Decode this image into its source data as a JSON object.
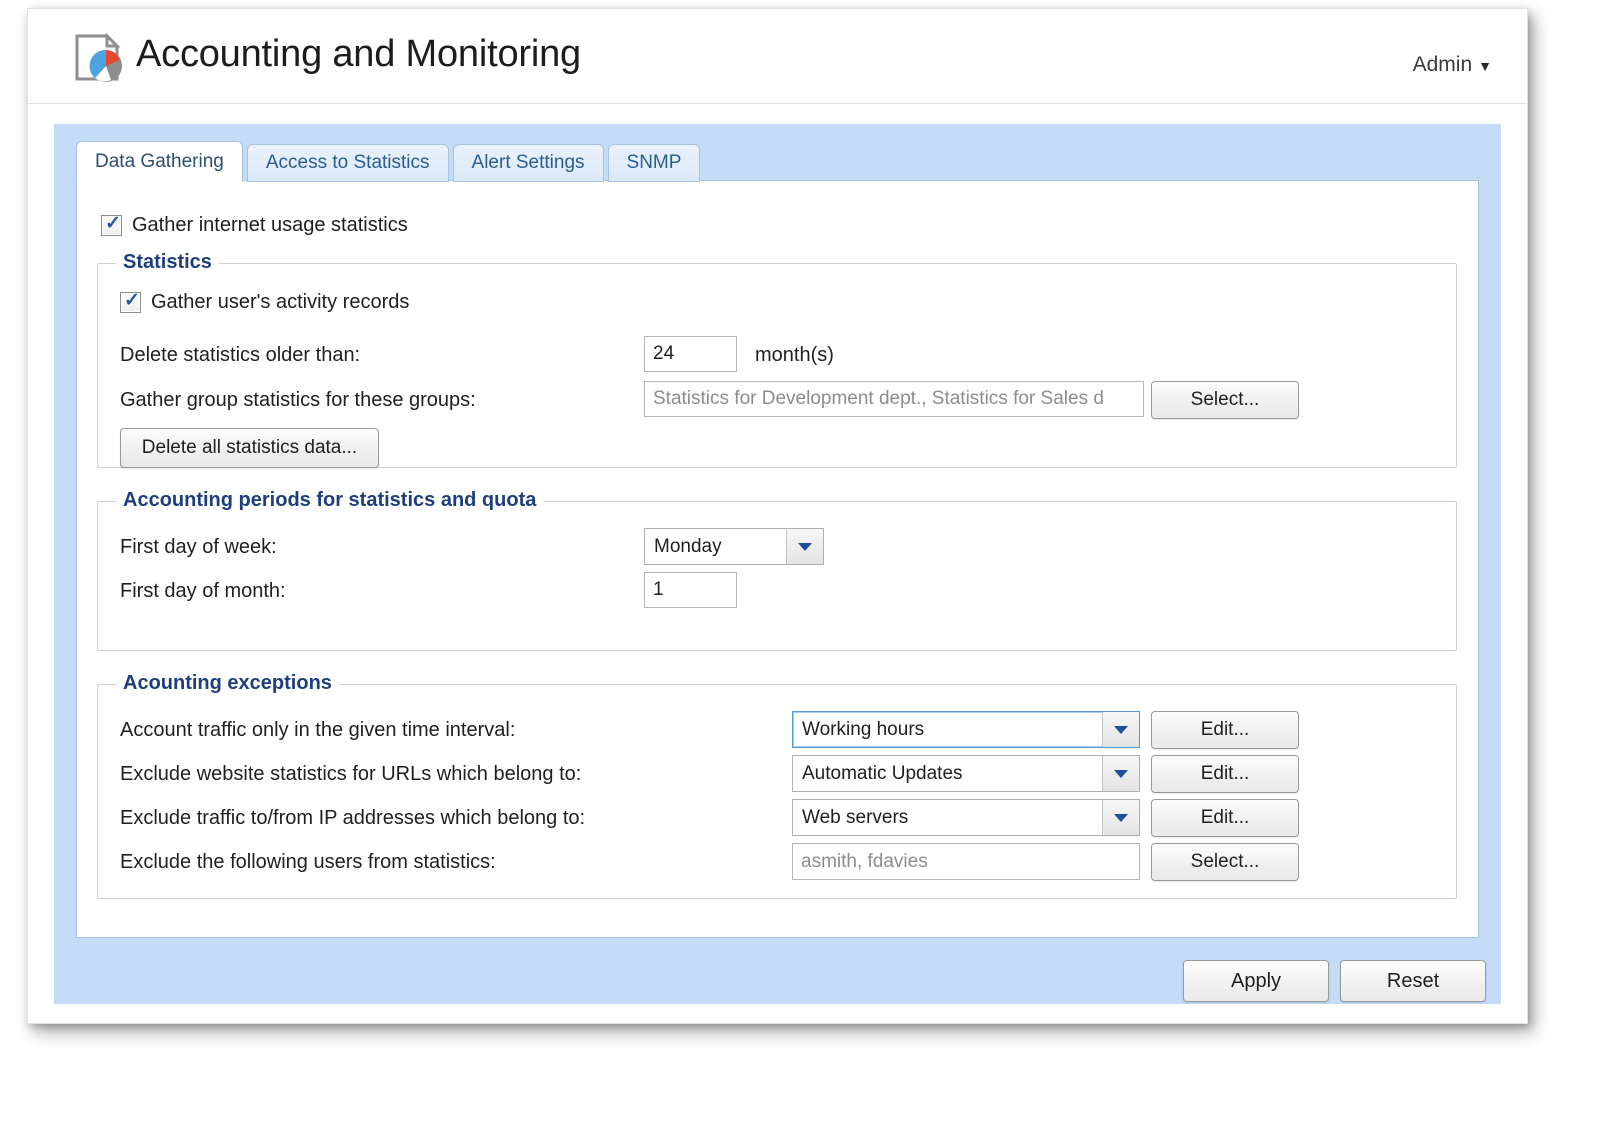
{
  "header": {
    "title": "Accounting and Monitoring",
    "icon": "document-pie-chart-icon",
    "admin_label": "Admin",
    "admin_caret": "▼"
  },
  "tabs": [
    {
      "label": "Data Gathering",
      "active": true
    },
    {
      "label": "Access to Statistics",
      "active": false
    },
    {
      "label": "Alert Settings",
      "active": false
    },
    {
      "label": "SNMP",
      "active": false
    }
  ],
  "main": {
    "gather_internet_usage": {
      "label": "Gather internet usage statistics",
      "checked": true,
      "check_glyph": "✓"
    },
    "statistics": {
      "legend": "Statistics",
      "gather_activity": {
        "label": "Gather user's activity records",
        "checked": true,
        "check_glyph": "✓"
      },
      "delete_older_label": "Delete statistics older than:",
      "delete_older_value": "24",
      "delete_older_unit": "month(s)",
      "group_stats_label": "Gather group statistics for these groups:",
      "group_stats_value": "Statistics for Development dept., Statistics for Sales d",
      "group_stats_select_label": "Select...",
      "delete_all_label": "Delete all statistics data..."
    },
    "accounting_periods": {
      "legend": "Accounting periods for statistics and quota",
      "first_day_week_label": "First day of week:",
      "first_day_week_value": "Monday",
      "first_day_month_label": "First day of month:",
      "first_day_month_value": "1"
    },
    "accounting_exceptions": {
      "legend": "Acounting exceptions",
      "rows": [
        {
          "label": "Account traffic only in the given time interval:",
          "value": "Working hours",
          "control": "dropdown",
          "focused": true,
          "button": "Edit..."
        },
        {
          "label": "Exclude website statistics for URLs which belong to:",
          "value": "Automatic Updates",
          "control": "dropdown",
          "focused": false,
          "button": "Edit..."
        },
        {
          "label": "Exclude traffic to/from IP addresses which belong to:",
          "value": "Web servers",
          "control": "dropdown",
          "focused": false,
          "button": "Edit..."
        },
        {
          "label": "Exclude the following users from statistics:",
          "value": "asmith, fdavies",
          "control": "textinput",
          "focused": false,
          "button": "Select..."
        }
      ]
    }
  },
  "footer": {
    "apply_label": "Apply",
    "reset_label": "Reset"
  },
  "colors": {
    "panel_blue": "#c5dcf7",
    "legend_blue": "#1f3f7a",
    "tab_text_blue": "#2c5d91",
    "focus_blue": "#5b9bd5",
    "icon_red": "#e8472e",
    "icon_blue": "#4da2e0",
    "icon_gray": "#8d8d8d"
  }
}
